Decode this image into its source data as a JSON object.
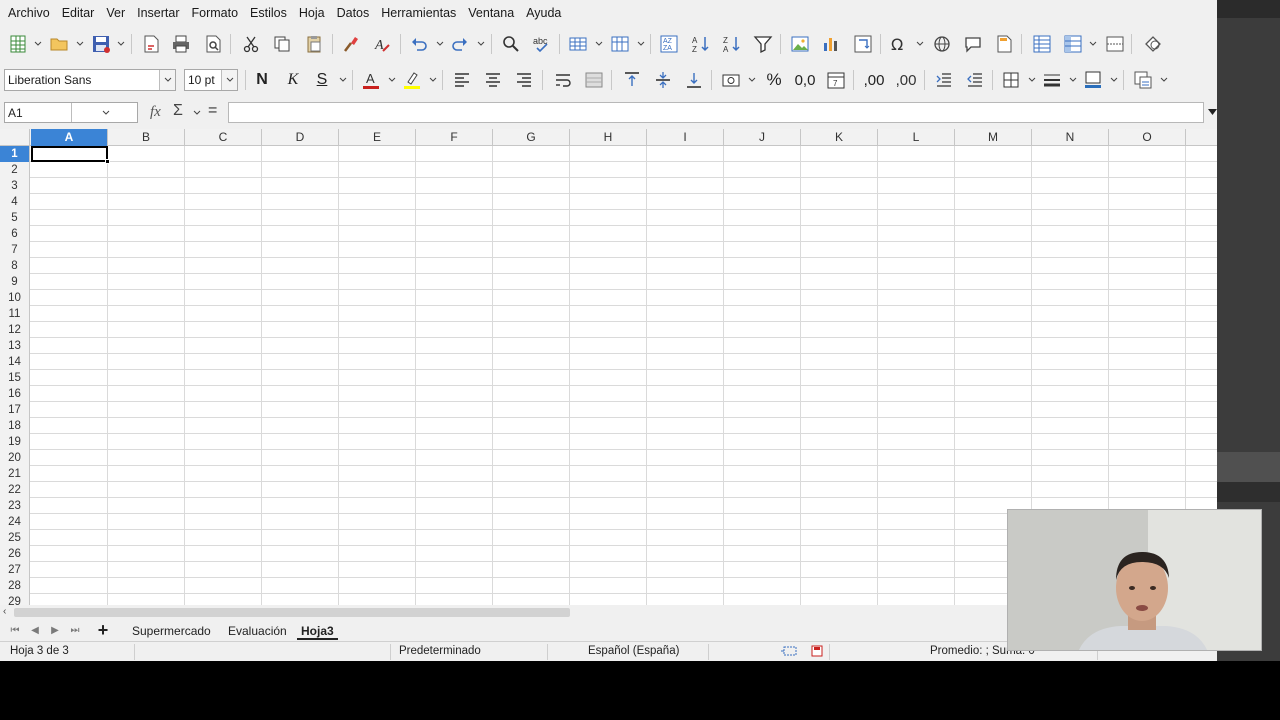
{
  "menu": [
    "Archivo",
    "Editar",
    "Ver",
    "Insertar",
    "Formato",
    "Estilos",
    "Hoja",
    "Datos",
    "Herramientas",
    "Ventana",
    "Ayuda"
  ],
  "format_toolbar": {
    "font_name": "Liberation Sans",
    "font_size": "10 pt",
    "bold_label": "N",
    "italic_label": "K",
    "underline_label": "S",
    "percent_label": "%",
    "number_label": "0,0",
    "add_decimal_label": ",00",
    "del_decimal_label": ",00"
  },
  "formula_bar": {
    "name_box": "A1",
    "fx_label": "fx",
    "sum_label": "Σ",
    "equals_label": "=",
    "formula_value": ""
  },
  "columns": [
    "A",
    "B",
    "C",
    "D",
    "E",
    "F",
    "G",
    "H",
    "I",
    "J",
    "K",
    "L",
    "M",
    "N",
    "O"
  ],
  "rows": [
    "1",
    "2",
    "3",
    "4",
    "5",
    "6",
    "7",
    "8",
    "9",
    "10",
    "11",
    "12",
    "13",
    "14",
    "15",
    "16",
    "17",
    "18",
    "19",
    "20",
    "21",
    "22",
    "23",
    "24",
    "25",
    "26",
    "27",
    "28",
    "29"
  ],
  "active_cell": "A1",
  "sheet_tabs": [
    "Supermercado",
    "Evaluación",
    "Hoja3"
  ],
  "active_sheet": "Hoja3",
  "status": {
    "sheet_position": "Hoja 3 de 3",
    "page_style": "Predeterminado",
    "language": "Español (España)",
    "selection_stats": "Promedio: ; Suma: 0"
  },
  "colors": {
    "accent": "#3b84d6",
    "font_color": "#c9211e",
    "highlight_color": "#ffff00",
    "border_color": "#2a6ebb"
  }
}
